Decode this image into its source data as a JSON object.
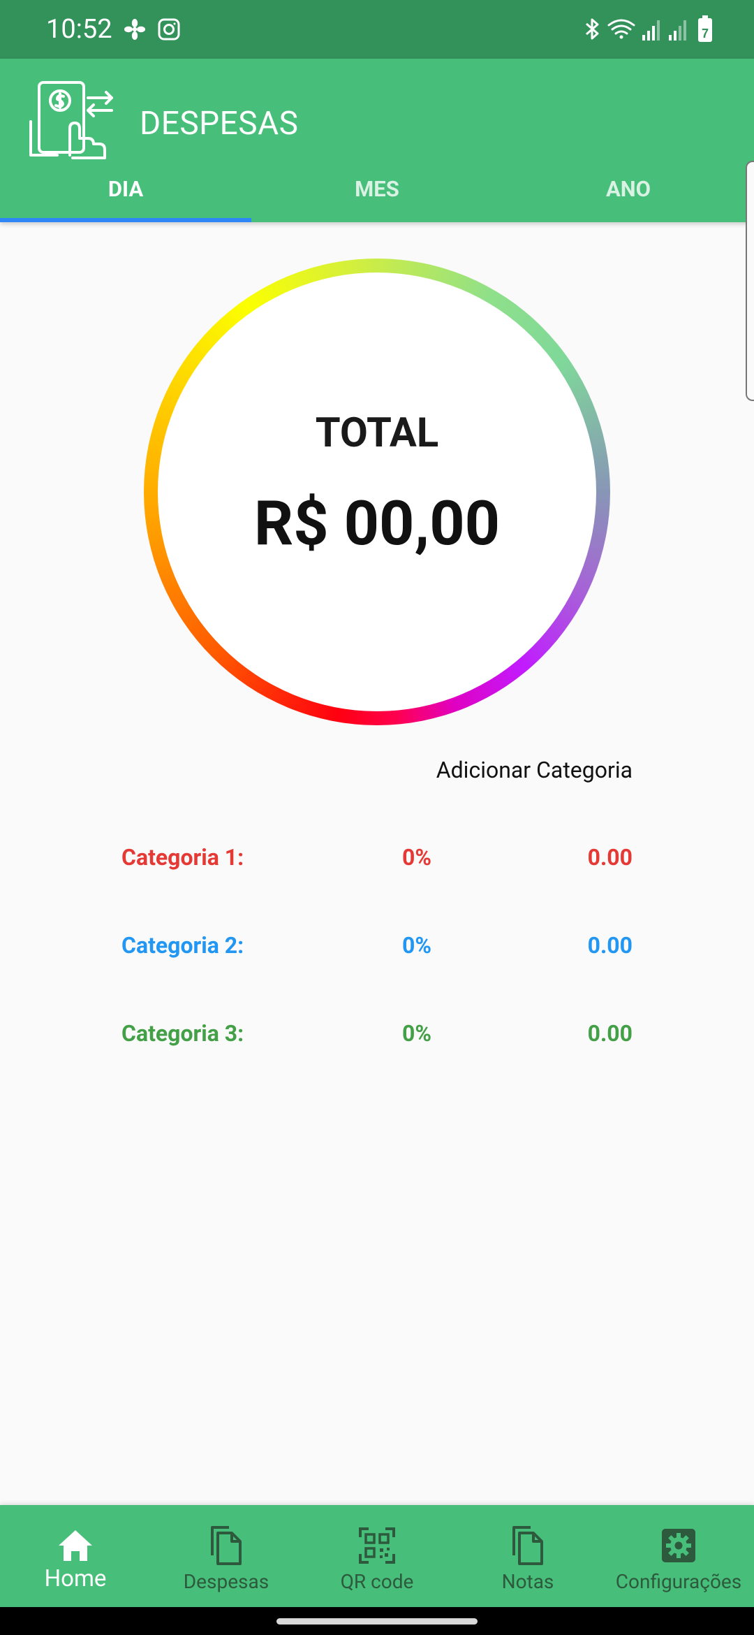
{
  "status_bar": {
    "time": "10:52",
    "battery_level": "7",
    "left_icons": [
      "fan-icon",
      "instagram-icon"
    ],
    "right_icons": [
      "bluetooth-icon",
      "wifi-icon",
      "signal-icon",
      "signal-icon",
      "battery-icon"
    ]
  },
  "app_bar": {
    "title": "DESPESAS",
    "logo_icon": "payment-hand-icon"
  },
  "tabs": [
    {
      "label": "DIA",
      "active": true
    },
    {
      "label": "MES",
      "active": false
    },
    {
      "label": "ANO",
      "active": false
    }
  ],
  "summary": {
    "total_label": "TOTAL",
    "total_value": "R$ 00,00"
  },
  "add_category_label": "Adicionar Categoria",
  "categories": [
    {
      "name": "Categoria 1:",
      "percent": "0%",
      "value": "0.00",
      "color": "#e53935"
    },
    {
      "name": "Categoria 2:",
      "percent": "0%",
      "value": "0.00",
      "color": "#2196f3"
    },
    {
      "name": "Categoria 3:",
      "percent": "0%",
      "value": "0.00",
      "color": "#43a047"
    }
  ],
  "bottom_nav": [
    {
      "label": "Home",
      "icon": "home-icon",
      "active": true
    },
    {
      "label": "Despesas",
      "icon": "copy-icon",
      "active": false
    },
    {
      "label": "QR code",
      "icon": "qr-code-icon",
      "active": false
    },
    {
      "label": "Notas",
      "icon": "copy-icon",
      "active": false
    },
    {
      "label": "Configurações",
      "icon": "settings-icon",
      "active": false
    }
  ],
  "colors": {
    "status_bar": "#33915a",
    "primary": "#47bf7a",
    "tab_indicator": "#2f86f6",
    "background": "#fafafa"
  }
}
